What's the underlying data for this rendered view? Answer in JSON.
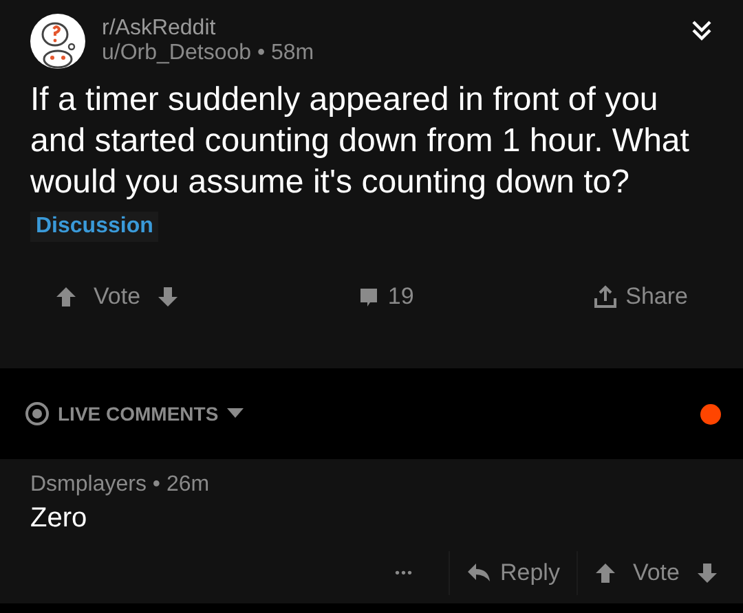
{
  "post": {
    "subreddit": "r/AskReddit",
    "author": "u/Orb_Detsoob",
    "separator": "•",
    "time": "58m",
    "title": "If a timer suddenly appeared in front of you and started counting down from 1 hour. What would you assume it's counting down to?",
    "flair": "Discussion",
    "actions": {
      "vote": "Vote",
      "comments": "19",
      "share": "Share"
    }
  },
  "live_comments": {
    "label": "LIVE COMMENTS"
  },
  "comments": [
    {
      "author": "Dsmplayers",
      "separator": "•",
      "time": "26m",
      "body": "Zero",
      "more": "•••",
      "reply": "Reply",
      "vote": "Vote"
    }
  ]
}
